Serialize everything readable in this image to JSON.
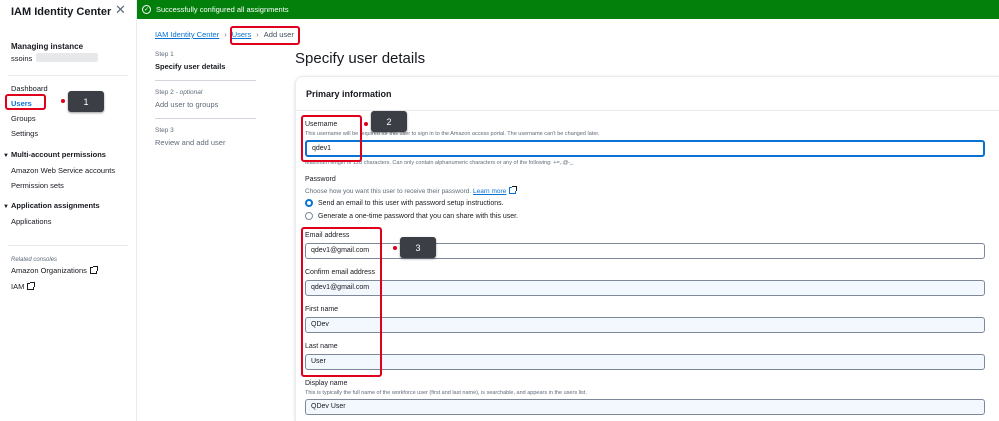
{
  "sidebar": {
    "title": "IAM Identity Center",
    "close_icon": "close-icon",
    "instance_label": "Managing instance",
    "instance_value": "ssoins",
    "items": [
      {
        "label": "Dashboard"
      },
      {
        "label": "Users"
      },
      {
        "label": "Groups"
      },
      {
        "label": "Settings"
      }
    ],
    "sections": [
      {
        "label": "Multi-account permissions",
        "items": [
          {
            "label": "Amazon Web Service accounts"
          },
          {
            "label": "Permission sets"
          }
        ]
      },
      {
        "label": "Application assignments",
        "items": [
          {
            "label": "Applications"
          }
        ]
      }
    ],
    "related_label": "Related consoles",
    "related": [
      {
        "label": "Amazon Organizations"
      },
      {
        "label": "IAM"
      }
    ]
  },
  "flash": {
    "message": "Successfully configured all assignments",
    "color": "#037f0c"
  },
  "breadcrumb": {
    "root": "IAM Identity Center",
    "users": "Users",
    "current": "Add user"
  },
  "steps": [
    {
      "label": "Step 1",
      "optional": "",
      "title": "Specify user details"
    },
    {
      "label": "Step 2 - ",
      "optional": "optional",
      "title": "Add user to groups"
    },
    {
      "label": "Step 3",
      "optional": "",
      "title": "Review and add user"
    }
  ],
  "page_title": "Specify user details",
  "form": {
    "section_title": "Primary information",
    "username": {
      "label": "Username",
      "desc": "This username will be required for this user to sign in to the Amazon access portal. The username can't be changed later.",
      "value": "qdev1",
      "constraint": "Maximum length of 128 characters. Can only contain alphanumeric characters or any of the following: +=,.@-_"
    },
    "password": {
      "label": "Password",
      "desc": "Choose how you want this user to receive their password.",
      "learn_more": "Learn more",
      "options": [
        {
          "label": "Send an email to this user with password setup instructions.",
          "checked": true
        },
        {
          "label": "Generate a one-time password that you can share with this user.",
          "checked": false
        }
      ]
    },
    "email": {
      "label": "Email address",
      "value": "qdev1@gmail.com"
    },
    "confirm_email": {
      "label": "Confirm email address",
      "value": "qdev1@gmail.com"
    },
    "first_name": {
      "label": "First name",
      "value": "QDev"
    },
    "last_name": {
      "label": "Last name",
      "value": "User"
    },
    "display_name": {
      "label": "Display name",
      "desc": "This is typically the full name of the workforce user (first and last name), is searchable, and appears in the users list.",
      "value": "QDev User"
    }
  },
  "annotations": [
    "1",
    "2",
    "3"
  ],
  "colors": {
    "accent": "#0972d3",
    "annotation": "#e0001b",
    "badge": "#3b3f45"
  }
}
